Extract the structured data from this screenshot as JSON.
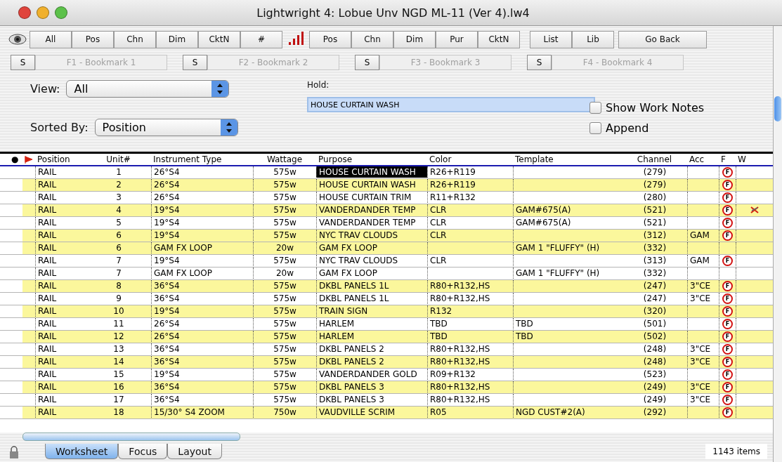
{
  "window": {
    "title": "Lightwright 4:  Lobue Unv NGD ML-11 (Ver 4).lw4"
  },
  "toolbar": {
    "view_buttons": [
      "All",
      "Pos",
      "Chn",
      "Dim",
      "CktN",
      "#"
    ],
    "sort_buttons": [
      "Pos",
      "Chn",
      "Dim",
      "Pur",
      "CktN"
    ],
    "list_buttons": [
      "List",
      "Lib"
    ],
    "back_button": "Go Back"
  },
  "bookmarks": [
    {
      "set": "S",
      "label": "F1 - Bookmark 1",
      "disabled": true
    },
    {
      "set": "S",
      "label": "F2 - Bookmark 2",
      "disabled": true
    },
    {
      "set": "S",
      "label": "F3 - Bookmark 3",
      "disabled": true
    },
    {
      "set": "S",
      "label": "F4 - Bookmark 4",
      "disabled": true
    }
  ],
  "view": {
    "label": "View:",
    "value": "All"
  },
  "sorted_by": {
    "label": "Sorted By:",
    "value": "Position"
  },
  "hold": {
    "label": "Hold:",
    "value": "HOUSE CURTAIN WASH"
  },
  "options": [
    {
      "label": "Show Work Notes",
      "checked": false
    },
    {
      "label": "Append",
      "checked": false
    }
  ],
  "table": {
    "marker_header": "●",
    "columns": [
      "Position",
      "Unit#",
      "Instrument Type",
      "Wattage",
      "Purpose",
      "Color",
      "Template",
      "Channel",
      "Acc",
      "F",
      "W"
    ],
    "rows": [
      {
        "highlighted": false,
        "purpose_selected": true,
        "w_marked": false,
        "cells": [
          "RAIL",
          "1",
          "26°S4",
          "575w",
          "HOUSE CURTAIN WASH",
          "R26+R119",
          "",
          "(279)",
          "",
          "F"
        ]
      },
      {
        "highlighted": true,
        "purpose_selected": false,
        "w_marked": false,
        "cells": [
          "RAIL",
          "2",
          "26°S4",
          "575w",
          "HOUSE CURTAIN WASH",
          "R26+R119",
          "",
          "(279)",
          "",
          "F"
        ]
      },
      {
        "highlighted": false,
        "purpose_selected": false,
        "w_marked": false,
        "cells": [
          "RAIL",
          "3",
          "26°S4",
          "575w",
          "HOUSE CURTAIN TRIM",
          "R11+R132",
          "",
          "(280)",
          "",
          "F"
        ]
      },
      {
        "highlighted": true,
        "purpose_selected": false,
        "w_marked": true,
        "cells": [
          "RAIL",
          "4",
          "19°S4",
          "575w",
          "VANDERDANDER TEMP",
          "CLR",
          "GAM#675(A)",
          "(521)",
          "",
          "F"
        ]
      },
      {
        "highlighted": false,
        "purpose_selected": false,
        "w_marked": false,
        "cells": [
          "RAIL",
          "5",
          "19°S4",
          "575w",
          "VANDERDANDER TEMP",
          "CLR",
          "GAM#675(A)",
          "(521)",
          "",
          "F"
        ]
      },
      {
        "highlighted": true,
        "purpose_selected": false,
        "w_marked": false,
        "cells": [
          "RAIL",
          "6",
          "19°S4",
          "575w",
          "NYC TRAV CLOUDS",
          "CLR",
          "",
          "(312)",
          "GAM",
          "F"
        ]
      },
      {
        "highlighted": true,
        "purpose_selected": false,
        "w_marked": false,
        "cells": [
          "RAIL",
          "6",
          "GAM FX LOOP",
          "20w",
          "GAM FX LOOP",
          "",
          "GAM 1 \"FLUFFY\" (H)",
          "(332)",
          "",
          ""
        ]
      },
      {
        "highlighted": false,
        "purpose_selected": false,
        "w_marked": false,
        "cells": [
          "RAIL",
          "7",
          "19°S4",
          "575w",
          "NYC TRAV CLOUDS",
          "CLR",
          "",
          "(313)",
          "GAM",
          "F"
        ]
      },
      {
        "highlighted": false,
        "purpose_selected": false,
        "w_marked": false,
        "cells": [
          "RAIL",
          "7",
          "GAM FX LOOP",
          "20w",
          "GAM FX LOOP",
          "",
          "GAM 1 \"FLUFFY\" (H)",
          "(332)",
          "",
          ""
        ]
      },
      {
        "highlighted": true,
        "purpose_selected": false,
        "w_marked": false,
        "cells": [
          "RAIL",
          "8",
          "36°S4",
          "575w",
          "DKBL PANELS 1L",
          "R80+R132,HS",
          "",
          "(247)",
          "3\"CE",
          "F"
        ]
      },
      {
        "highlighted": false,
        "purpose_selected": false,
        "w_marked": false,
        "cells": [
          "RAIL",
          "9",
          "36°S4",
          "575w",
          "DKBL PANELS 1L",
          "R80+R132,HS",
          "",
          "(247)",
          "3\"CE",
          "F"
        ]
      },
      {
        "highlighted": true,
        "purpose_selected": false,
        "w_marked": false,
        "cells": [
          "RAIL",
          "10",
          "19°S4",
          "575w",
          "TRAIN SIGN",
          "R132",
          "",
          "(320)",
          "",
          "F"
        ]
      },
      {
        "highlighted": false,
        "purpose_selected": false,
        "w_marked": false,
        "cells": [
          "RAIL",
          "11",
          "26°S4",
          "575w",
          "HARLEM",
          "TBD",
          "TBD",
          "(501)",
          "",
          "F"
        ]
      },
      {
        "highlighted": true,
        "purpose_selected": false,
        "w_marked": false,
        "cells": [
          "RAIL",
          "12",
          "26°S4",
          "575w",
          "HARLEM",
          "TBD",
          "TBD",
          "(502)",
          "",
          "F"
        ]
      },
      {
        "highlighted": false,
        "purpose_selected": false,
        "w_marked": false,
        "cells": [
          "RAIL",
          "13",
          "36°S4",
          "575w",
          "DKBL PANELS 2",
          "R80+R132,HS",
          "",
          "(248)",
          "3\"CE",
          "F"
        ]
      },
      {
        "highlighted": true,
        "purpose_selected": false,
        "w_marked": false,
        "cells": [
          "RAIL",
          "14",
          "36°S4",
          "575w",
          "DKBL PANELS 2",
          "R80+R132,HS",
          "",
          "(248)",
          "3\"CE",
          "F"
        ]
      },
      {
        "highlighted": false,
        "purpose_selected": false,
        "w_marked": false,
        "cells": [
          "RAIL",
          "15",
          "19°S4",
          "575w",
          "VANDERDANDER GOLD",
          "R09+R132",
          "",
          "(523)",
          "",
          "F"
        ]
      },
      {
        "highlighted": true,
        "purpose_selected": false,
        "w_marked": false,
        "cells": [
          "RAIL",
          "16",
          "36°S4",
          "575w",
          "DKBL PANELS 3",
          "R80+R132,HS",
          "",
          "(249)",
          "3\"CE",
          "F"
        ]
      },
      {
        "highlighted": false,
        "purpose_selected": false,
        "w_marked": false,
        "cells": [
          "RAIL",
          "17",
          "36°S4",
          "575w",
          "DKBL PANELS 3",
          "R80+R132,HS",
          "",
          "(249)",
          "3\"CE",
          "F"
        ]
      },
      {
        "highlighted": true,
        "purpose_selected": false,
        "w_marked": false,
        "cells": [
          "RAIL",
          "18",
          "15/30° S4 ZOOM",
          "750w",
          "VAUDVILLE SCRIM",
          "R05",
          "NGD CUST#2(A)",
          "(292)",
          "",
          "F"
        ]
      }
    ]
  },
  "tabs": [
    {
      "label": "Worksheet",
      "selected": true
    },
    {
      "label": "Focus",
      "selected": false
    },
    {
      "label": "Layout",
      "selected": false
    }
  ],
  "status": "1143 items"
}
